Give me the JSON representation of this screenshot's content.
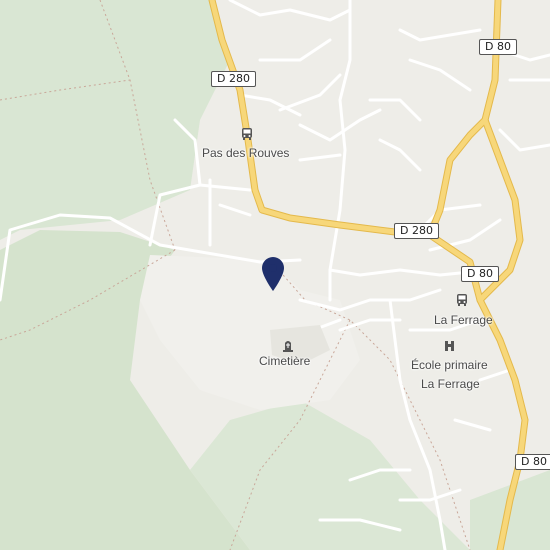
{
  "map": {
    "colors": {
      "land": "#eeede8",
      "forest": "#d9e6d3",
      "forest_dark": "#cadcc1",
      "clearing": "#f1f0ec",
      "major_road": "#f7d77a",
      "major_road_edge": "#e4b94b",
      "minor_road": "#ffffff",
      "pin": "#1f2f6b",
      "boundary": "#c9a799"
    },
    "road_shields": [
      {
        "id": "d280-west",
        "text": "D 280"
      },
      {
        "id": "d280-east",
        "text": "D 280"
      },
      {
        "id": "d80-north",
        "text": "D 80"
      },
      {
        "id": "d80-mid",
        "text": "D 80"
      },
      {
        "id": "d80-south",
        "text": "D 80"
      }
    ],
    "places": [
      {
        "id": "pas-des-rouves",
        "label": "Pas des Rouves",
        "icon": "bus-stop-icon"
      },
      {
        "id": "la-ferrage-stop",
        "label": "La Ferrage",
        "icon": "bus-stop-icon"
      },
      {
        "id": "cimetiere",
        "label": "Cimetière",
        "icon": "cemetery-icon"
      },
      {
        "id": "ecole",
        "label": "École primaire",
        "label2": "La Ferrage",
        "icon": "school-icon"
      }
    ],
    "marker": {
      "icon": "location-pin-icon"
    }
  }
}
